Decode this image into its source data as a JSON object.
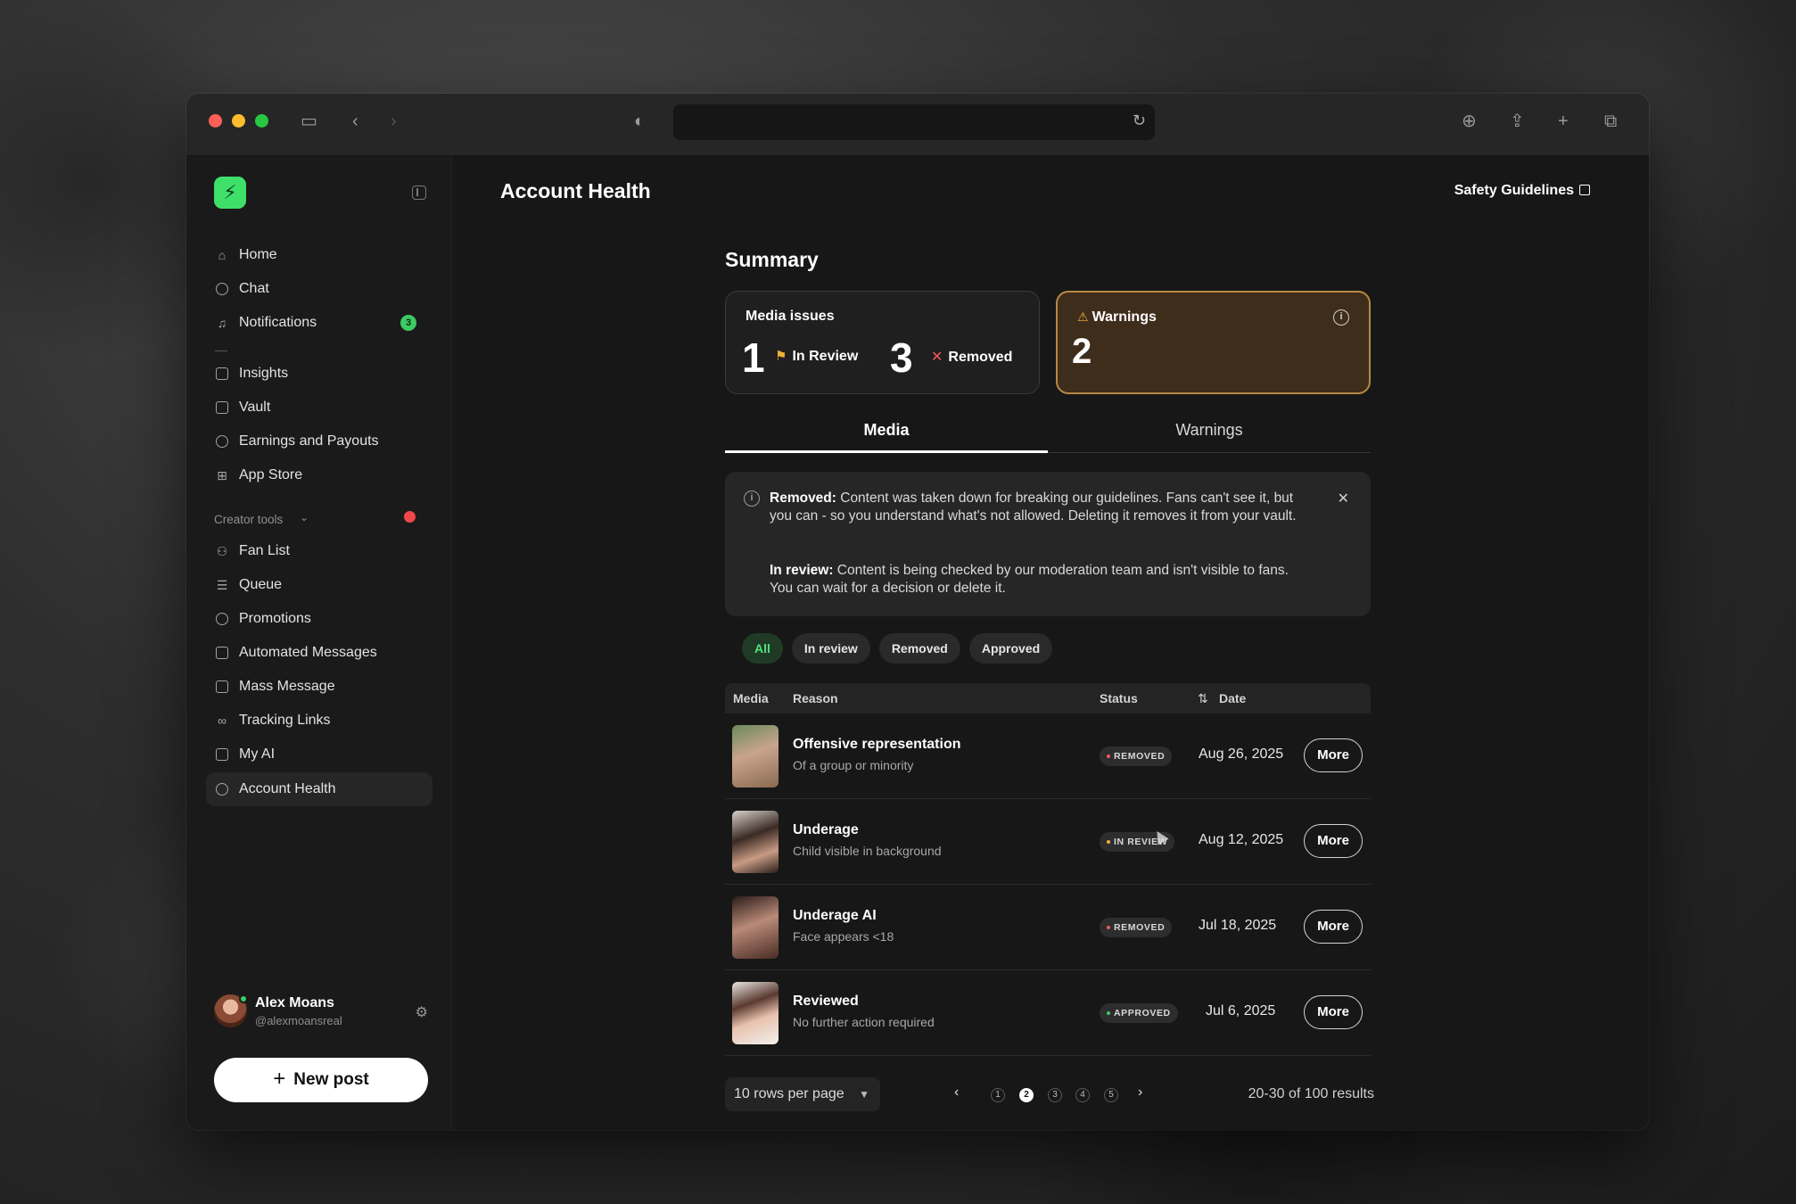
{
  "browser": {
    "url": ""
  },
  "app": {
    "page_title": "Account Health",
    "safety_link": "Safety Guidelines"
  },
  "sidebar": {
    "primary": [
      {
        "label": "Home",
        "icon": "home-icon"
      },
      {
        "label": "Chat",
        "icon": "chat-icon"
      },
      {
        "label": "Notifications",
        "icon": "bell-icon",
        "badge": "3"
      }
    ],
    "secondary": [
      {
        "label": "Insights",
        "icon": "chart-icon"
      },
      {
        "label": "Vault",
        "icon": "vault-icon"
      },
      {
        "label": "Earnings and Payouts",
        "icon": "dollar-icon"
      },
      {
        "label": "App Store",
        "icon": "grid-icon"
      }
    ],
    "section_label": "Creator tools",
    "tools": [
      {
        "label": "Fan List",
        "icon": "people-icon"
      },
      {
        "label": "Queue",
        "icon": "list-icon"
      },
      {
        "label": "Promotions",
        "icon": "percent-icon"
      },
      {
        "label": "Automated Messages",
        "icon": "message-auto-icon"
      },
      {
        "label": "Mass Message",
        "icon": "mass-message-icon"
      },
      {
        "label": "Tracking Links",
        "icon": "link-icon"
      },
      {
        "label": "My AI",
        "icon": "ai-icon"
      },
      {
        "label": "Account Health",
        "icon": "health-icon",
        "active": true
      }
    ],
    "profile": {
      "name": "Alex Moans",
      "handle": "@alexmoansreal"
    },
    "new_post": "New post"
  },
  "summary": {
    "title": "Summary",
    "media_issues": {
      "label": "Media issues",
      "in_review_count": "1",
      "in_review_label": "In Review",
      "removed_count": "3",
      "removed_label": "Removed"
    },
    "warnings": {
      "label": "Warnings",
      "count": "2"
    }
  },
  "tabs": [
    "Media",
    "Warnings"
  ],
  "notice": {
    "removed_title": "Removed:",
    "removed_text": " Content was taken down for breaking our guidelines. Fans can't see it, but you can - so you understand what's not allowed. Deleting it removes it from your vault.",
    "review_title": "In review:",
    "review_text": " Content is being checked by our moderation team and isn't visible to fans. You can wait for a decision or delete it."
  },
  "filters": [
    "All",
    "In review",
    "Removed",
    "Approved"
  ],
  "table": {
    "headers": {
      "media": "Media",
      "reason": "Reason",
      "status": "Status",
      "date": "Date"
    },
    "rows": [
      {
        "title": "Offensive representation",
        "sub": "Of a group or minority",
        "status": "REMOVED",
        "date": "Aug 26, 2025",
        "action": "More"
      },
      {
        "title": "Underage",
        "sub": "Child visible in background",
        "status": "IN REVIEW",
        "date": "Aug 12, 2025",
        "action": "More"
      },
      {
        "title": "Underage AI",
        "sub": "Face appears <18",
        "status": "REMOVED",
        "date": "Jul 18, 2025",
        "action": "More"
      },
      {
        "title": "Reviewed",
        "sub": "No further action required",
        "status": "APPROVED",
        "date": "Jul 6, 2025",
        "action": "More"
      }
    ]
  },
  "pagination": {
    "rows_per_page": "10 rows per page",
    "pages": [
      "1",
      "2",
      "3",
      "4",
      "5"
    ],
    "current": "2",
    "results": "20-30 of 100 results"
  },
  "colors": {
    "accent_green": "#3ee06a",
    "warning_border": "#b98845",
    "removed_red": "#f05b5b",
    "review_amber": "#f0b03a"
  }
}
